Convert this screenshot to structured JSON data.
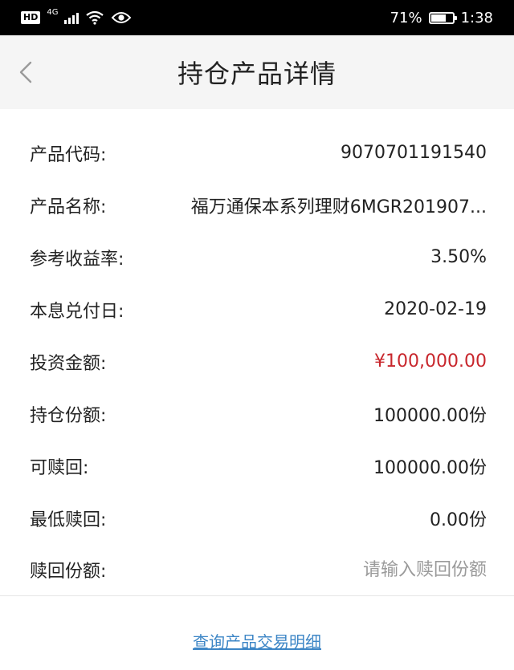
{
  "status_bar": {
    "hd": "HD",
    "network": "4G",
    "battery_text": "71%",
    "battery_level": 0.71,
    "time": "1:38"
  },
  "header": {
    "title": "持仓产品详情"
  },
  "fields": [
    {
      "label": "产品代码:",
      "value": "9070701191540"
    },
    {
      "label": "产品名称:",
      "value": "福万通保本系列理财6MGR201907..."
    },
    {
      "label": "参考收益率:",
      "value": "3.50%"
    },
    {
      "label": "本息兑付日:",
      "value": "2020-02-19"
    },
    {
      "label": "投资金额:",
      "value": "¥100,000.00"
    },
    {
      "label": "持仓份额:",
      "value": "100000.00份"
    },
    {
      "label": "可赎回:",
      "value": "100000.00份"
    },
    {
      "label": "最低赎回:",
      "value": "0.00份"
    }
  ],
  "redeem": {
    "label": "赎回份额:",
    "placeholder": "请输入赎回份额"
  },
  "footer": {
    "link_text": "查询产品交易明细"
  },
  "colors": {
    "amount": "#c8262c",
    "link": "#3d86c6",
    "header_bg": "#f5f5f5"
  }
}
